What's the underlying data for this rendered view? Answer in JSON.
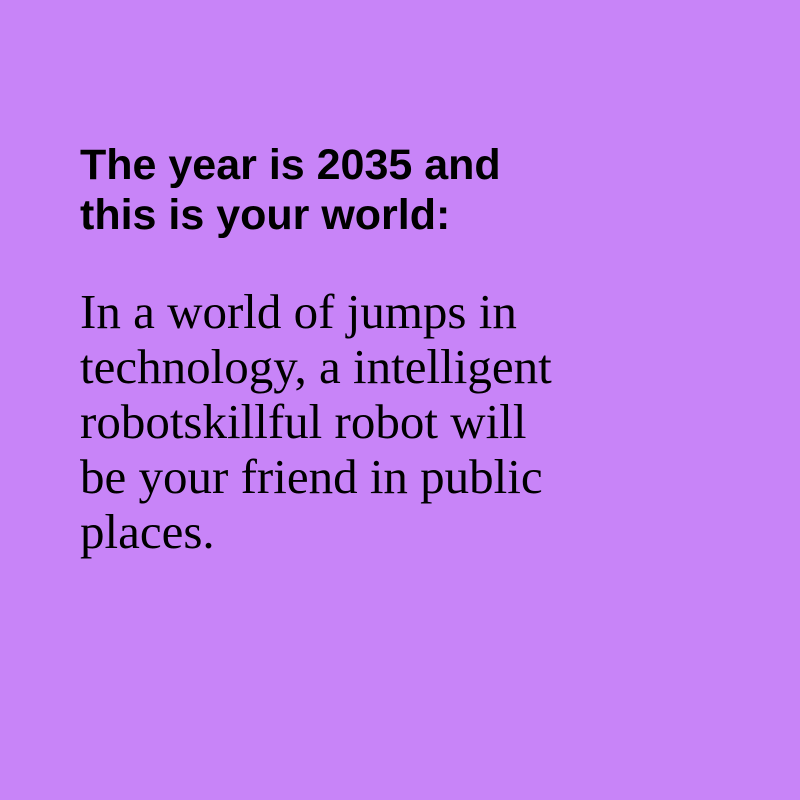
{
  "colors": {
    "background": "#c884f8",
    "text": "#000000"
  },
  "heading": {
    "lines": [
      "The year is 2035 and",
      "this is your world:"
    ]
  },
  "body": {
    "lines": [
      "In a world of jumps in",
      "technology, a intelligent",
      "robotskillful robot will",
      "be your friend in public",
      "places."
    ]
  }
}
